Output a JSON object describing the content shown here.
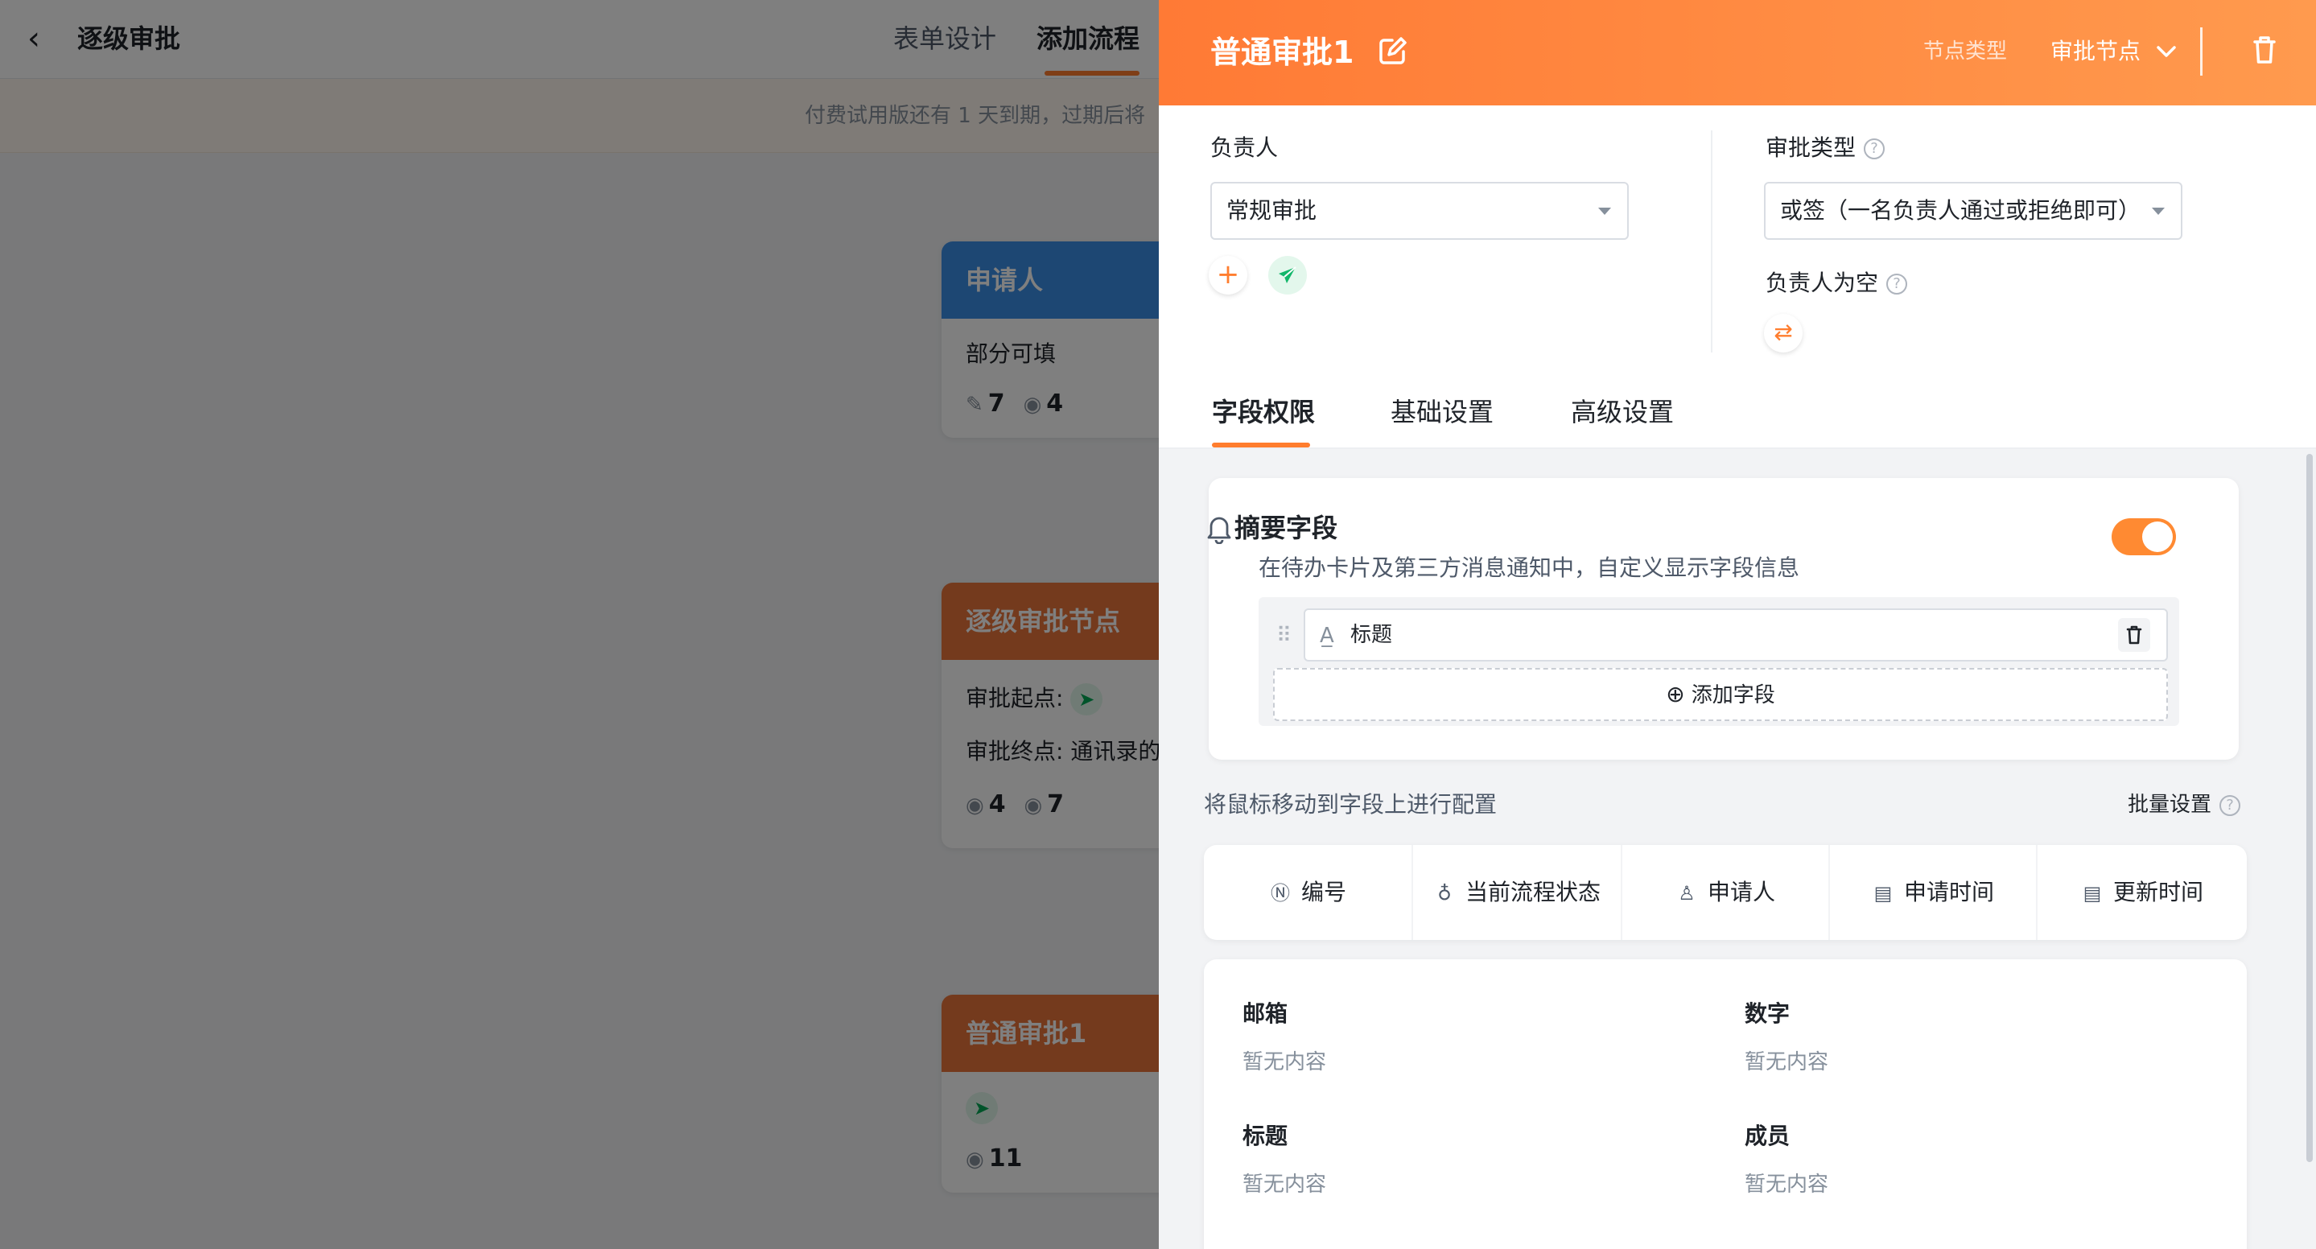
{
  "background": {
    "title": "逐级审批",
    "tabs": [
      "表单设计",
      "添加流程"
    ],
    "active_tab": "添加流程",
    "notice": "付费试用版还有 1 天到期，过期后将",
    "nodes": [
      {
        "title": "申请人",
        "color": "#3a8ee6",
        "line1": "部分可填",
        "edit_count": "7",
        "view_count": "4"
      },
      {
        "title": "逐级审批节点",
        "color": "#e8743b",
        "line1": "审批起点:",
        "line2": "审批终点: 通讯录的",
        "view_count": "4",
        "edit_count": "7"
      },
      {
        "title": "普通审批1",
        "color": "#e8743b",
        "view_count": "11"
      }
    ]
  },
  "drawer": {
    "title": "普通审批1",
    "node_type_label": "节点类型",
    "node_type_value": "审批节点",
    "owner_label": "负责人",
    "owner_select": "常规审批",
    "approval_type_label": "审批类型",
    "approval_type_select": "或签（一名负责人通过或拒绝即可）",
    "owner_empty_label": "负责人为空",
    "tabs": [
      "字段权限",
      "基础设置",
      "高级设置"
    ],
    "active_tab": "字段权限",
    "summary": {
      "title": "摘要字段",
      "description": "在待办卡片及第三方消息通知中，自定义显示字段信息",
      "enabled": true,
      "fields": [
        "标题"
      ],
      "add_label": "添加字段"
    },
    "hint": "将鼠标移动到字段上进行配置",
    "batch_label": "批量设置",
    "system_fields": [
      {
        "label": "编号",
        "icon": "number-icon"
      },
      {
        "label": "当前流程状态",
        "icon": "flow-icon"
      },
      {
        "label": "申请人",
        "icon": "user-icon"
      },
      {
        "label": "申请时间",
        "icon": "calendar-icon"
      },
      {
        "label": "更新时间",
        "icon": "calendar-icon"
      }
    ],
    "form_fields": [
      {
        "label": "邮箱",
        "value": "暂无内容"
      },
      {
        "label": "数字",
        "value": "暂无内容"
      },
      {
        "label": "标题",
        "value": "暂无内容"
      },
      {
        "label": "成员",
        "value": "暂无内容"
      }
    ],
    "accent_color": "#ff7d2e"
  }
}
